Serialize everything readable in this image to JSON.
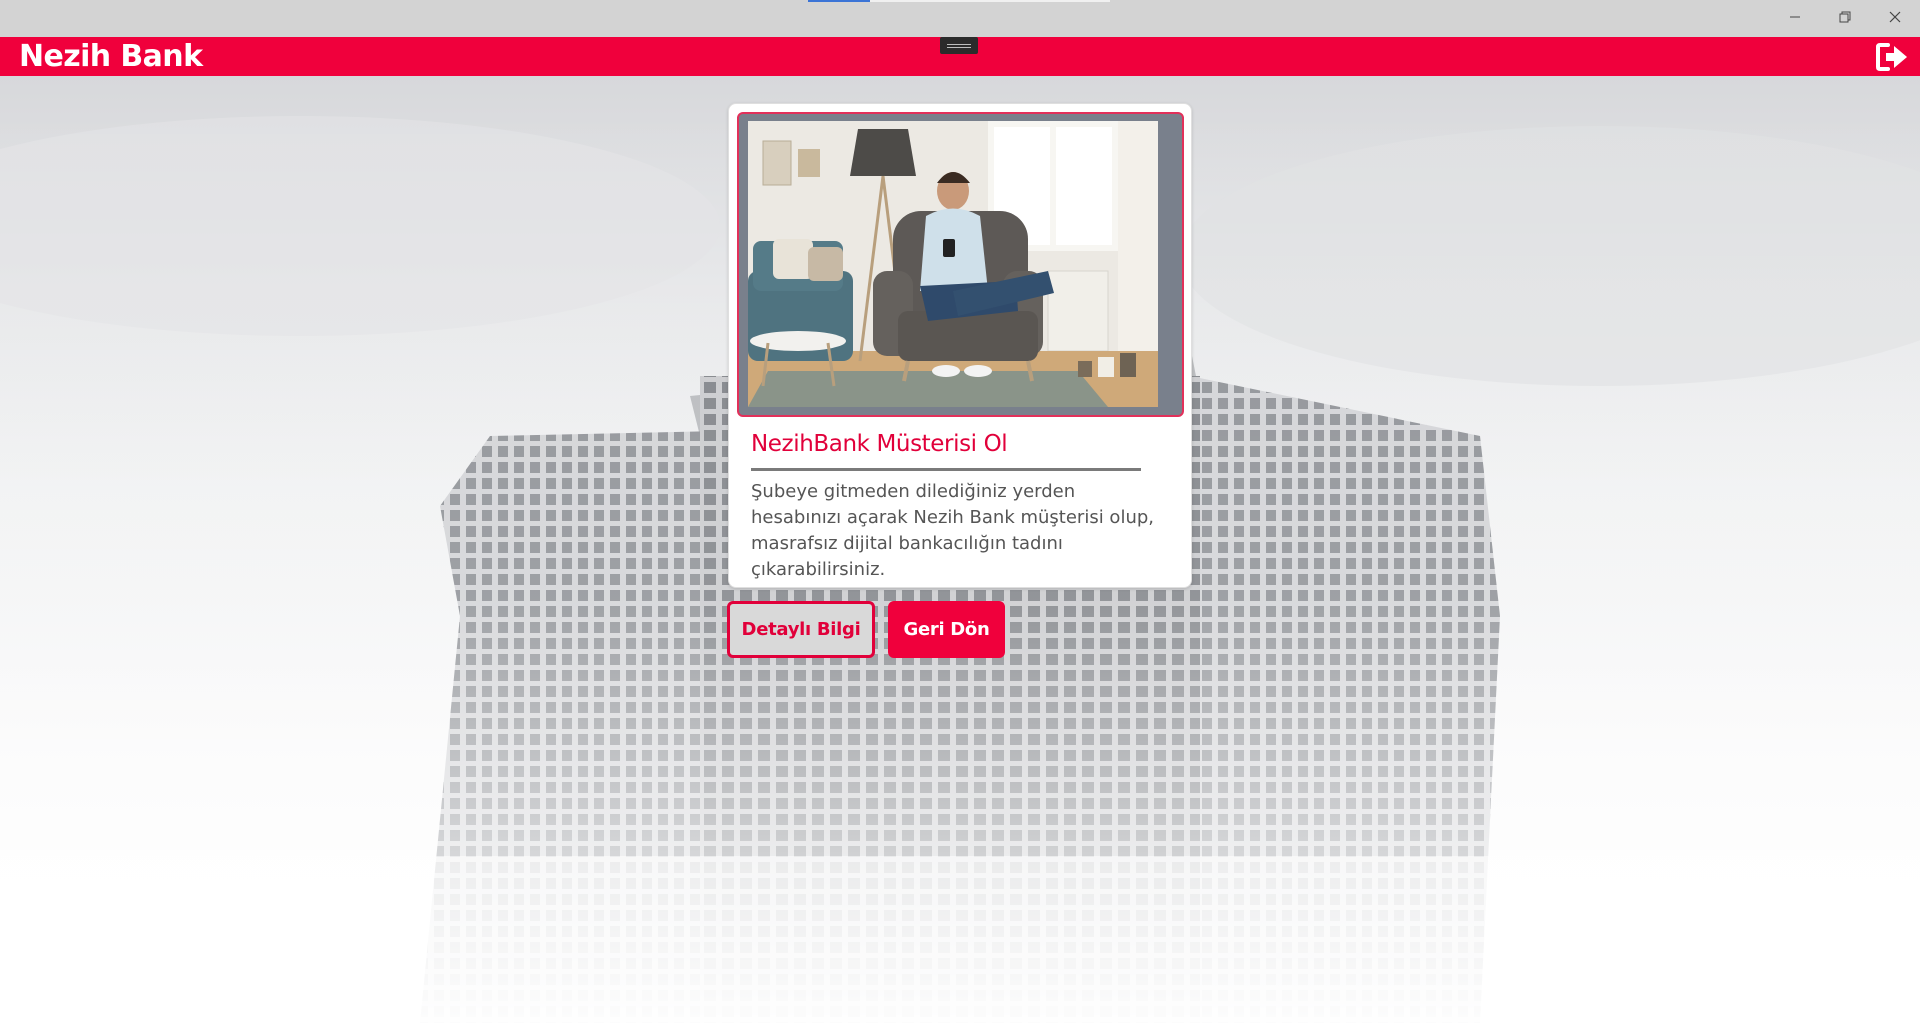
{
  "window": {
    "minimize_icon": "minimize-icon",
    "maximize_icon": "restore-icon",
    "close_icon": "close-icon"
  },
  "header": {
    "brand": "Nezih Bank",
    "logout_icon": "logout-icon",
    "accent_color": "#f0003c"
  },
  "card": {
    "image_alt": "man-sitting-in-armchair-with-phone",
    "title": "NezihBank Müsterisi Ol",
    "body": "Şubeye gitmeden dilediğiniz yerden hesabınızı açarak Nezih Bank müşterisi olup, masrafsız dijital bankacılığın tadını çıkarabilirsiniz."
  },
  "actions": {
    "detail_label": "Detaylı Bilgi",
    "back_label": "Geri Dön"
  }
}
